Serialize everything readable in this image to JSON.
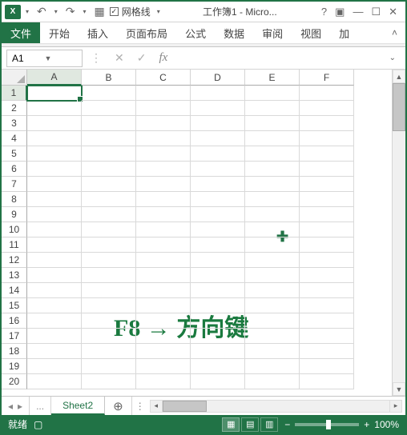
{
  "qat": {
    "gridlines_label": "网格线",
    "title": "工作簿1 - Micro..."
  },
  "tabs": {
    "file": "文件",
    "home": "开始",
    "insert": "插入",
    "layout": "页面布局",
    "formulas": "公式",
    "data": "数据",
    "review": "审阅",
    "view": "视图",
    "addins": "加"
  },
  "formula_bar": {
    "name": "A1",
    "fx": "fx"
  },
  "columns": [
    "A",
    "B",
    "C",
    "D",
    "E",
    "F"
  ],
  "rows": [
    "1",
    "2",
    "3",
    "4",
    "5",
    "6",
    "7",
    "8",
    "9",
    "10",
    "11",
    "12",
    "13",
    "14",
    "15",
    "16",
    "17",
    "18",
    "19",
    "20"
  ],
  "active_cell": "A1",
  "overlay_text": "F8 → 方向键",
  "sheet": {
    "name": "Sheet2",
    "dots": "..."
  },
  "status": {
    "ready": "就绪",
    "zoom": "100%"
  }
}
